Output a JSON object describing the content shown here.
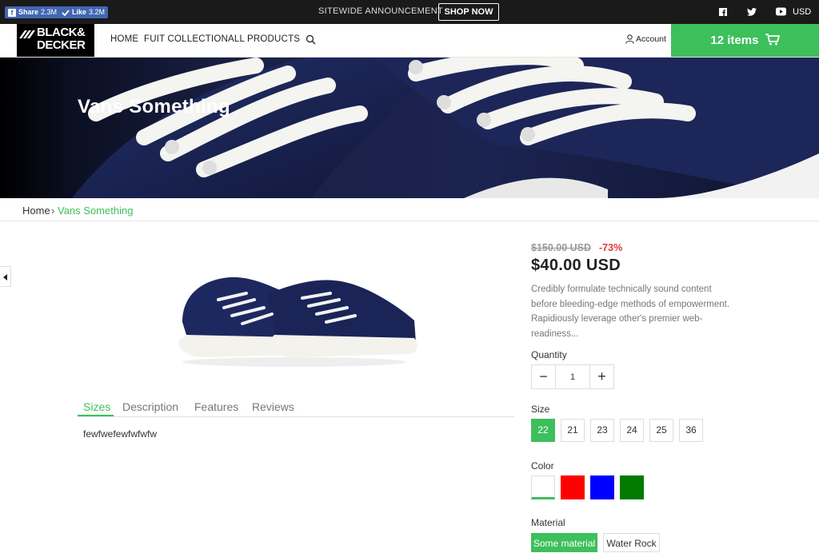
{
  "topbar": {
    "fb_share_label": "Share",
    "fb_share_count": "2.3M",
    "fb_like_label": "Like",
    "fb_like_count": "3.2M",
    "announcement": "SITEWIDE ANNOUNCEMENT",
    "shop_now": "SHOP NOW",
    "currency": "USD"
  },
  "header": {
    "logo_line1": "BLACK&",
    "logo_line2": "DECKER",
    "nav": [
      "HOME",
      "FUIT COLLECTION",
      "ALL PRODUCTS"
    ],
    "account": "Account",
    "cart": "12 items"
  },
  "hero": {
    "title": "Vans Something"
  },
  "breadcrumb": {
    "home": "Home",
    "separator": "›",
    "current": "Vans Something"
  },
  "product": {
    "compare_price": "$150.00 USD",
    "discount": "-73%",
    "price": "$40.00 USD",
    "description": "Credibly formulate technically sound content before bleeding-edge methods of empowerment. Rapidiously leverage other's premier web-readiness...",
    "quantity_label": "Quantity",
    "quantity_value": "1",
    "size_label": "Size",
    "sizes": [
      "22",
      "21",
      "23",
      "24",
      "25",
      "36"
    ],
    "color_label": "Color",
    "colors": [
      "#ffffff",
      "#ff0000",
      "#0000ff",
      "#007a00"
    ],
    "material_label": "Material",
    "materials": [
      "Some material",
      "Water Rock"
    ]
  },
  "tabs": {
    "items": [
      "Sizes",
      "Description",
      "Features",
      "Reviews"
    ],
    "content": "fewfwefewfwfwfw"
  },
  "colors": {
    "accent": "#3dbf5c",
    "sale": "#e53935",
    "topbar": "#1a1a1a"
  }
}
